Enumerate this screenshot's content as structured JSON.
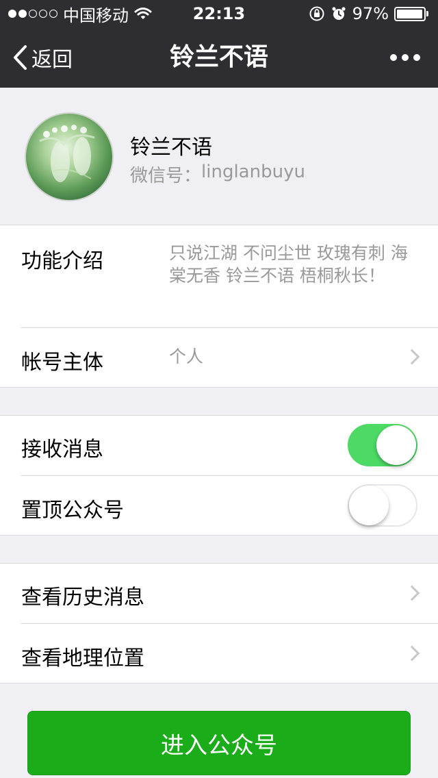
{
  "status_bar": {
    "carrier": "中国移动",
    "time": "22:13",
    "battery": "97%",
    "battery_level": 0.97,
    "signal_bars_filled": 2,
    "signal_bars_total": 5,
    "icons": [
      "wifi-icon",
      "rotation-lock-icon",
      "alarm-icon",
      "battery-icon"
    ]
  },
  "nav": {
    "back_label": "返回",
    "title": "铃兰不语",
    "more_icon": "more-dots-icon"
  },
  "profile": {
    "name": "铃兰不语",
    "id_label": "微信号：",
    "id_value": "linglanbuyu"
  },
  "info": {
    "intro_label": "功能介绍",
    "intro_value": "只说江湖 不问尘世 玫瑰有刺 海棠无香  铃兰不语  梧桐秋长！",
    "account_label": "帐号主体",
    "account_value": "个人"
  },
  "settings": {
    "receive_label": "接收消息",
    "receive_on": true,
    "pin_label": "置顶公众号",
    "pin_on": false
  },
  "history": {
    "history_label": "查看历史消息",
    "location_label": "查看地理位置"
  },
  "enter_button": "进入公众号",
  "colors": {
    "bar_bg": "#2e2e32",
    "page_bg": "#efeff4",
    "toggle_on": "#4cd964",
    "primary_button": "#1aad19"
  }
}
